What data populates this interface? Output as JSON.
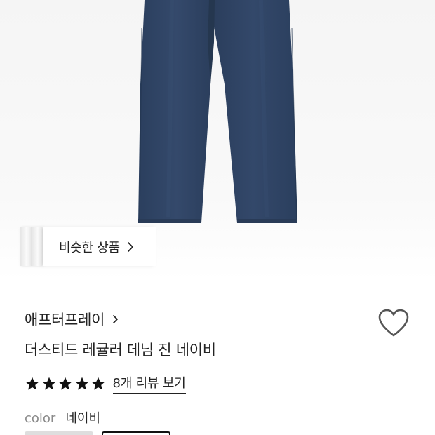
{
  "product_image": {
    "subject": "jeans-photo",
    "jeans_color": "#2f4566"
  },
  "similar_products": {
    "label": "비슷한 상품"
  },
  "brand": {
    "name": "애프터프레이"
  },
  "product": {
    "title": "더스티드 레귤러 데님 진 네이비"
  },
  "rating": {
    "stars": 5,
    "max_stars": 5,
    "review_link": "8개 리뷰 보기"
  },
  "color": {
    "label": "color",
    "value": "네이비"
  },
  "colors": {
    "accent": "#222222",
    "muted": "#8a8a8a",
    "wish_outline": "#555555"
  }
}
